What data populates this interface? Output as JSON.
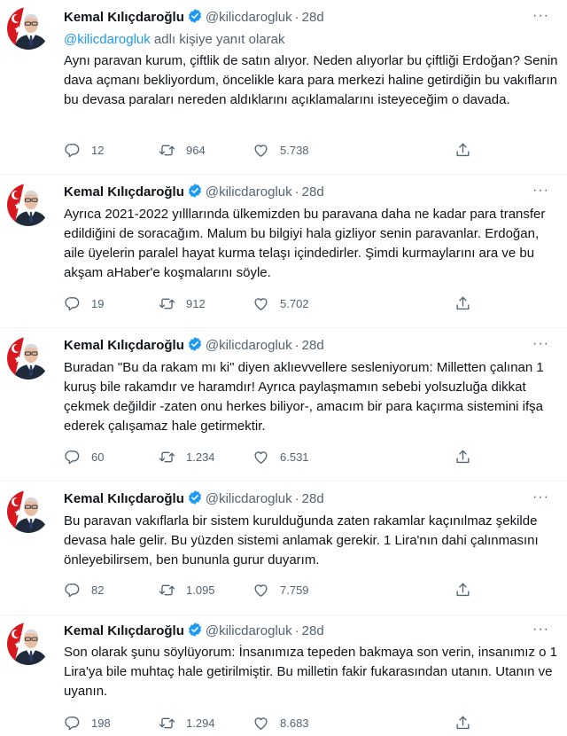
{
  "author": {
    "name": "Kemal Kılıçdaroğlu",
    "handle": "@kilicdarogluk",
    "verified": true
  },
  "icons": {
    "reply": "reply-icon",
    "retweet": "retweet-icon",
    "like": "heart-icon",
    "share": "share-icon",
    "more": "more-icon",
    "verified": "verified-badge-icon"
  },
  "colors": {
    "accent": "#1d9bf0",
    "secondary_text": "#536471"
  },
  "tweets": [
    {
      "time": "28d",
      "reply_to": {
        "mention": "@kilicdarogluk",
        "suffix": " adlı kişiye yanıt olarak"
      },
      "text": "Aynı paravan kurum, çiftlik de satın alıyor. Neden alıyorlar bu çiftliği Erdoğan? Senin dava açmanı bekliyordum, öncelikle kara para merkezi haline getirdiğin bu vakıfların bu devasa paraları nereden aldıklarını açıklamalarını isteyeceğim o davada.",
      "replies": "12",
      "retweets": "964",
      "likes": "5.738"
    },
    {
      "time": "28d",
      "text": "Ayrıca 2021-2022 yılllarında ülkemizden bu paravana daha ne kadar para transfer edildiğini de soracağım. Malum bu bilgiyi hala gizliyor senin paravanlar. Erdoğan, aile üyelerin paralel hayat kurma telaşı içindedirler. Şimdi kurmaylarını ara ve bu akşam aHaber'e koşmalarını söyle.",
      "replies": "19",
      "retweets": "912",
      "likes": "5.702"
    },
    {
      "time": "28d",
      "text": "Buradan \"Bu da rakam mı ki\" diyen aklıevvellere sesleniyorum: Milletten çalınan 1 kuruş bile rakamdır ve haramdır! Ayrıca paylaşmamın sebebi yolsuzluğa dikkat çekmek değildir -zaten onu herkes biliyor-, amacım bir para kaçırma sistemini ifşa ederek çalışamaz hale getirmektir.",
      "replies": "60",
      "retweets": "1.234",
      "likes": "6.531"
    },
    {
      "time": "28d",
      "text": "Bu paravan vakıflarla bir sistem kurulduğunda zaten rakamlar kaçınılmaz şekilde devasa hale gelir. Bu yüzden sistemi anlamak gerekir. 1 Lira'nın dahi çalınmasını önleyebilirsem, ben bununla gurur duyarım.",
      "replies": "82",
      "retweets": "1.095",
      "likes": "7.759"
    },
    {
      "time": "28d",
      "text": "Son olarak şunu söylüyorum: İnsanımıza tepeden bakmaya son verin, insanımız o 1 Lira'ya bile muhtaç hale getirilmiştir. Bu milletin fakir fukarasından utanın. Utanın ve uyanın.",
      "replies": "198",
      "retweets": "1.294",
      "likes": "8.683"
    }
  ]
}
